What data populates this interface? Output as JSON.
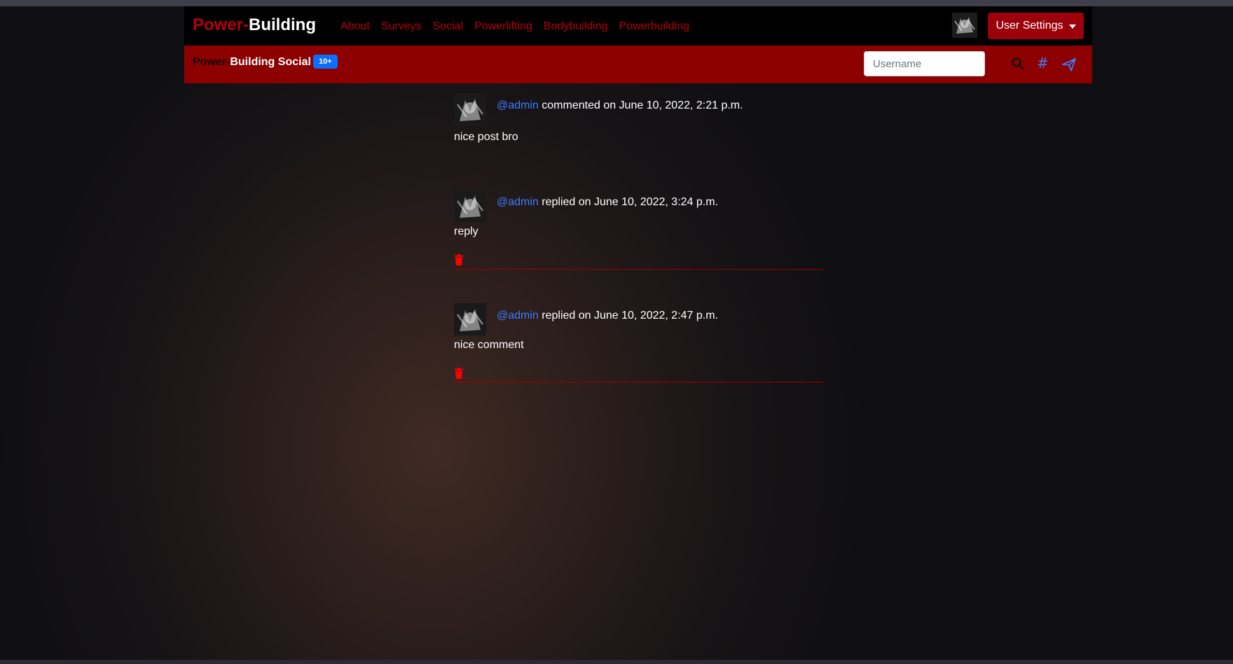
{
  "navbar": {
    "brand_part1": "Power-",
    "brand_part2": "Building",
    "links": [
      "About",
      "Surveys",
      "Social",
      "Powerlifting",
      "Bodybuilding",
      "Powerbuilding"
    ],
    "user_settings_label": "User Settings"
  },
  "subbar": {
    "brand_part1": "Power-",
    "brand_part2": "Building Social",
    "badge": "10+",
    "search_placeholder": "Username",
    "hash_icon_text": "#"
  },
  "comments": [
    {
      "user": "@admin",
      "action": " commented on June 10, 2022, 2:21 p.m.",
      "body": "nice post bro",
      "deletable": false
    },
    {
      "user": "@admin",
      "action": " replied on June 10, 2022, 3:24 p.m.",
      "body": "reply",
      "deletable": true
    },
    {
      "user": "@admin",
      "action": " replied on June 10, 2022, 2:47 p.m.",
      "body": "nice comment",
      "deletable": true
    }
  ],
  "colors": {
    "brand_red": "#b3000c",
    "subbar_red": "#8c0000",
    "button_red": "#9b000b",
    "link_blue": "#3d7cff",
    "badge_blue": "#0d6efd",
    "trash_red": "#ff0000"
  }
}
